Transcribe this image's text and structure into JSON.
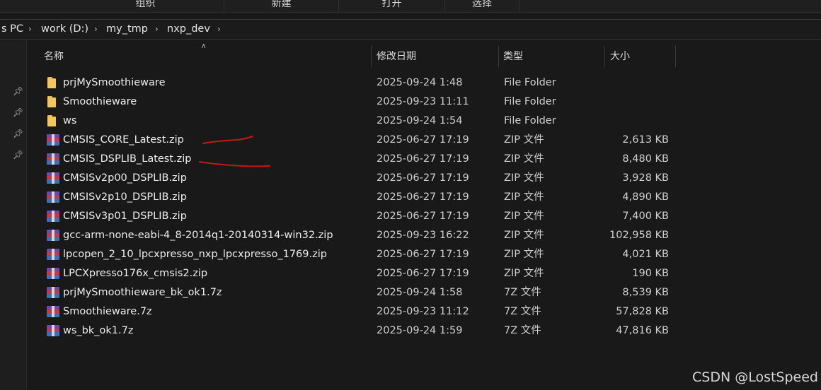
{
  "ribbon": {
    "groups": [
      "组织",
      "新建",
      "打开",
      "选择"
    ]
  },
  "address": {
    "crumbs": [
      "s PC",
      "work (D:)",
      "my_tmp",
      "nxp_dev"
    ]
  },
  "columns": {
    "name": "名称",
    "date": "修改日期",
    "type": "类型",
    "size": "大小"
  },
  "files": [
    {
      "name": "prjMySmoothieware",
      "date": "2025-09-24 1:48",
      "type": "File Folder",
      "size": "",
      "icon": "folder-icon"
    },
    {
      "name": "Smoothieware",
      "date": "2025-09-23 11:11",
      "type": "File Folder",
      "size": "",
      "icon": "folder-icon"
    },
    {
      "name": "ws",
      "date": "2025-09-24 1:54",
      "type": "File Folder",
      "size": "",
      "icon": "folder-icon"
    },
    {
      "name": "CMSIS_CORE_Latest.zip",
      "date": "2025-06-27 17:19",
      "type": "ZIP 文件",
      "size": "2,613 KB",
      "icon": "archive-icon"
    },
    {
      "name": "CMSIS_DSPLIB_Latest.zip",
      "date": "2025-06-27 17:19",
      "type": "ZIP 文件",
      "size": "8,480 KB",
      "icon": "archive-icon"
    },
    {
      "name": "CMSISv2p00_DSPLIB.zip",
      "date": "2025-06-27 17:19",
      "type": "ZIP 文件",
      "size": "3,928 KB",
      "icon": "archive-icon"
    },
    {
      "name": "CMSISv2p10_DSPLIB.zip",
      "date": "2025-06-27 17:19",
      "type": "ZIP 文件",
      "size": "4,890 KB",
      "icon": "archive-icon"
    },
    {
      "name": "CMSISv3p01_DSPLIB.zip",
      "date": "2025-06-27 17:19",
      "type": "ZIP 文件",
      "size": "7,400 KB",
      "icon": "archive-icon"
    },
    {
      "name": "gcc-arm-none-eabi-4_8-2014q1-20140314-win32.zip",
      "date": "2025-09-23 16:22",
      "type": "ZIP 文件",
      "size": "102,958 KB",
      "icon": "archive-icon"
    },
    {
      "name": "lpcopen_2_10_lpcxpresso_nxp_lpcxpresso_1769.zip",
      "date": "2025-06-27 17:19",
      "type": "ZIP 文件",
      "size": "4,021 KB",
      "icon": "archive-icon"
    },
    {
      "name": "LPCXpresso176x_cmsis2.zip",
      "date": "2025-06-27 17:19",
      "type": "ZIP 文件",
      "size": "190 KB",
      "icon": "archive-icon"
    },
    {
      "name": "prjMySmoothieware_bk_ok1.7z",
      "date": "2025-09-24 1:58",
      "type": "7Z 文件",
      "size": "8,539 KB",
      "icon": "archive-icon"
    },
    {
      "name": "Smoothieware.7z",
      "date": "2025-09-23 11:12",
      "type": "7Z 文件",
      "size": "57,828 KB",
      "icon": "archive-icon"
    },
    {
      "name": "ws_bk_ok1.7z",
      "date": "2025-09-24 1:59",
      "type": "7Z 文件",
      "size": "47,816 KB",
      "icon": "archive-icon"
    }
  ],
  "pins": [
    "pin-icon",
    "pin-icon",
    "pin-icon",
    "pin-icon"
  ],
  "annotation_color": "#c41818",
  "watermark": "CSDN @LostSpeed"
}
